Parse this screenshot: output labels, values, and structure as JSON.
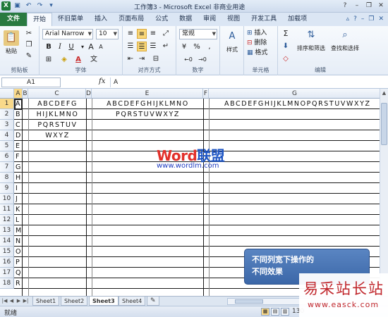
{
  "app": {
    "title": "工作簿3 - Microsoft Excel 非商业用途",
    "colors": {
      "file_tab": "#2a7a40",
      "selection_header": "#f9d98a",
      "callout": "#3b67a8"
    }
  },
  "qat": {
    "excel_icon": "X",
    "save_icon": "save-icon",
    "undo_icon": "undo-icon",
    "redo_icon": "redo-icon"
  },
  "window_buttons": {
    "help": "?",
    "minimize": "–",
    "restore": "❐",
    "close": "✕"
  },
  "tabs": [
    "文件",
    "开始",
    "怀旧菜单",
    "插入",
    "页面布局",
    "公式",
    "数据",
    "审阅",
    "视图",
    "开发工具",
    "加载项"
  ],
  "ribbon": {
    "clipboard": {
      "paste": "粘贴",
      "label": "剪贴板"
    },
    "font": {
      "name": "Arial Narrow",
      "size": "10",
      "bold": "B",
      "italic": "I",
      "underline": "U",
      "grow": "A",
      "shrink": "A",
      "wen": "文",
      "label": "字体"
    },
    "alignment": {
      "label": "对齐方式"
    },
    "number": {
      "format": "常规",
      "percent": "%",
      "comma": ",",
      "label": "数字"
    },
    "styles": {
      "button": "样式"
    },
    "cells": {
      "insert": "插入",
      "delete": "删除",
      "format": "格式",
      "label": "单元格"
    },
    "editing": {
      "sum": "Σ",
      "sort": "排序和筛选",
      "find": "查找和选择",
      "label": "编辑"
    }
  },
  "formula_bar": {
    "name_box": "A1",
    "fx": "fx",
    "content": "A"
  },
  "columns": [
    "A",
    "B",
    "C",
    "D",
    "E",
    "F",
    "G"
  ],
  "rows": [
    "1",
    "2",
    "3",
    "4",
    "5",
    "6",
    "7",
    "8",
    "9",
    "10",
    "11",
    "12",
    "13",
    "14",
    "15",
    "16",
    "17",
    "18"
  ],
  "cells": {
    "colA": [
      "A",
      "B",
      "C",
      "D",
      "E",
      "F",
      "G",
      "H",
      "I",
      "J",
      "K",
      "L",
      "M",
      "N",
      "O",
      "P",
      "Q",
      "R"
    ],
    "colC": [
      "ABCDEFG",
      "HIJKLMNO",
      "PQRSTUV",
      "WXYZ"
    ],
    "colE": [
      "ABCDEFGHIJKLMNO",
      "PQRSTUVWXYZ"
    ],
    "colG": [
      "ABCDEFGHIJKLMNOPQRSTUVWXYZ"
    ]
  },
  "watermark": {
    "word": "Word",
    "lianmeng": "联盟",
    "url": "www.wordlm.com"
  },
  "callout": {
    "line1": "不同列宽下操作的",
    "line2": "不同效果"
  },
  "sheets": [
    "Sheet1",
    "Sheet2",
    "Sheet3",
    "Sheet4"
  ],
  "active_sheet": "Sheet3",
  "status": {
    "ready": "就绪",
    "zoom": "130"
  },
  "brand": {
    "name": "易采站长站",
    "url": "www.easck.com"
  }
}
